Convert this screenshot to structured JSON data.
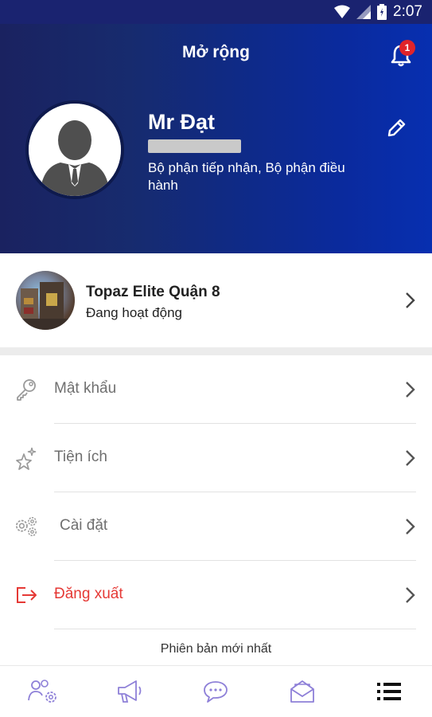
{
  "status_bar": {
    "time": "2:07"
  },
  "header": {
    "title": "Mở rộng",
    "notification_count": "1"
  },
  "profile": {
    "name": "Mr Đạt",
    "department": "Bộ phận tiếp nhận, Bộ phận điều hành"
  },
  "building": {
    "name": "Topaz Elite Quận 8",
    "status": "Đang hoạt động"
  },
  "menu": {
    "items": [
      {
        "label": "Mật khẩu",
        "icon": "key-icon"
      },
      {
        "label": "Tiện ích",
        "icon": "sparkle-star-icon"
      },
      {
        "label": "Cài đặt",
        "icon": "gears-icon"
      },
      {
        "label": "Đăng xuất",
        "icon": "logout-icon"
      }
    ]
  },
  "version_text": "Phiên bản mới nhất",
  "bottom_nav": {
    "items": [
      {
        "icon": "users-gear-icon"
      },
      {
        "icon": "megaphone-icon"
      },
      {
        "icon": "chat-icon"
      },
      {
        "icon": "mail-icon"
      },
      {
        "icon": "menu-list-icon",
        "active": true
      }
    ]
  },
  "colors": {
    "header_dark": "#1a2260",
    "header_light": "#072fb0",
    "logout_red": "#e53935",
    "badge_red": "#e0242a",
    "nav_icon": "#8e80d8"
  }
}
